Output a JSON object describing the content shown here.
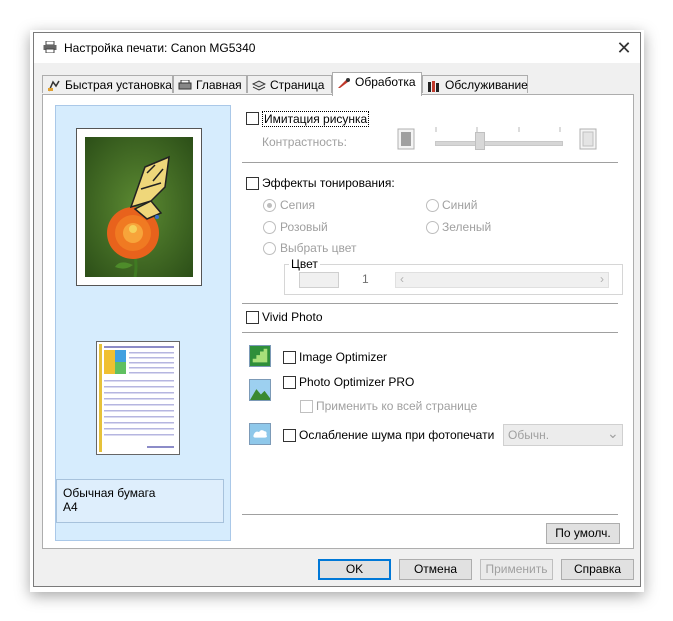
{
  "window": {
    "title": "Настройка печати: Canon MG5340",
    "close_glyph": "✕"
  },
  "tabs": [
    {
      "label": "Быстрая установка",
      "icon": "quick-setup-icon"
    },
    {
      "label": "Главная",
      "icon": "main-icon"
    },
    {
      "label": "Страница",
      "icon": "page-setup-icon"
    },
    {
      "label": "Обработка",
      "icon": "effects-icon",
      "active": true
    },
    {
      "label": "Обслуживание",
      "icon": "maintenance-icon"
    }
  ],
  "preview": {
    "paper_type": "Обычная бумага",
    "paper_size": "A4"
  },
  "simulate": {
    "label": "Имитация рисунка",
    "checked": false,
    "contrast_label": "Контрастность:"
  },
  "toning": {
    "label": "Эффекты тонирования:",
    "checked": false,
    "options": [
      "Сепия",
      "Синий",
      "Розовый",
      "Зеленый",
      "Выбрать цвет"
    ],
    "selected": "Сепия",
    "color_group": "Цвет",
    "color_value": "1",
    "scroll_left": "‹",
    "scroll_right": "›"
  },
  "vivid": {
    "label": "Vivid Photo",
    "checked": false
  },
  "image_optimizer": {
    "label": "Image Optimizer",
    "checked": false
  },
  "photo_optimizer": {
    "label": "Photo Optimizer PRO",
    "checked": false,
    "apply_all_label": "Применить ко всей странице"
  },
  "noise": {
    "label": "Ослабление шума при фотопечати",
    "checked": false,
    "select_value": "Обычн.",
    "select_arrow": "⌄"
  },
  "buttons": {
    "defaults": "По умолч.",
    "ok": "OK",
    "cancel": "Отмена",
    "apply": "Применить",
    "help": "Справка"
  },
  "colors": {
    "accent": "#0078d7",
    "preview_bg": "#d6ecfd"
  }
}
